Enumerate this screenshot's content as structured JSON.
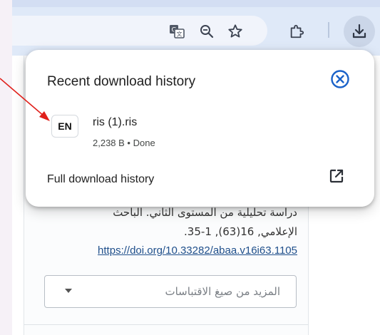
{
  "colors": {
    "toolbar_bg": "#dfe9f8",
    "download_button_bg": "#cbd6e8",
    "close_icon": "#1a62c9",
    "annotation_arrow": "#e0201b",
    "link": "#1f4f8b"
  },
  "toolbar": {
    "icons": [
      "translate-icon",
      "zoom-icon",
      "bookmark-star-icon",
      "extensions-icon",
      "download-icon"
    ]
  },
  "downloads_popup": {
    "title": "Recent download history",
    "close_icon": "close-circle-icon",
    "items": [
      {
        "badge": "EN",
        "file_name": "ris (1).ris",
        "meta": "2,238 B • Done"
      }
    ],
    "full_history_label": "Full download history",
    "open_icon": "open-in-new-icon"
  },
  "citation": {
    "line1": "دراسة تحليلية من المستوى الثاني. الباحث",
    "line2": "الإعلامي, 16(63), 1-35.",
    "doi": "https://doi.org/10.33282/abaa.v16i63.1105"
  },
  "more_formats_select": {
    "placeholder": "المزيد من صيغ الاقتباسات"
  }
}
